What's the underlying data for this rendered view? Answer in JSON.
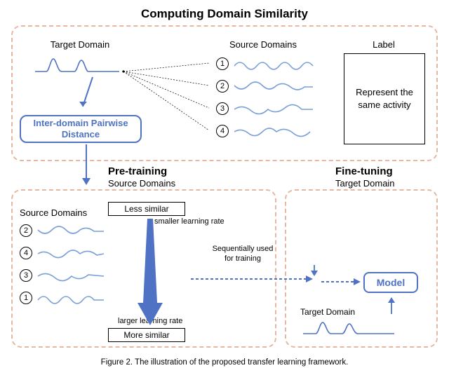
{
  "title": "Computing Domain Similarity",
  "caption": "Figure 2.   The illustration of the proposed transfer learning framework.",
  "top": {
    "target_label": "Target Domain",
    "source_label": "Source Domains",
    "label_heading": "Label",
    "label_text": "Represent the same activity",
    "ipd": "Inter-domain Pairwise Distance",
    "src_ids": [
      "1",
      "2",
      "3",
      "4"
    ]
  },
  "pretrain": {
    "heading": "Pre-training",
    "sub": "Source Domains",
    "list_label": "Source Domains",
    "less": "Less similar",
    "more": "More similar",
    "less_note": "smaller learning rate",
    "more_note": "larger learning rate",
    "ordered_ids": [
      "2",
      "4",
      "3",
      "1"
    ]
  },
  "finetune": {
    "heading": "Fine-tuning",
    "sub": "Target Domain",
    "model": "Model",
    "seq_note": "Sequentially used for training",
    "target_label": "Target Domain"
  }
}
